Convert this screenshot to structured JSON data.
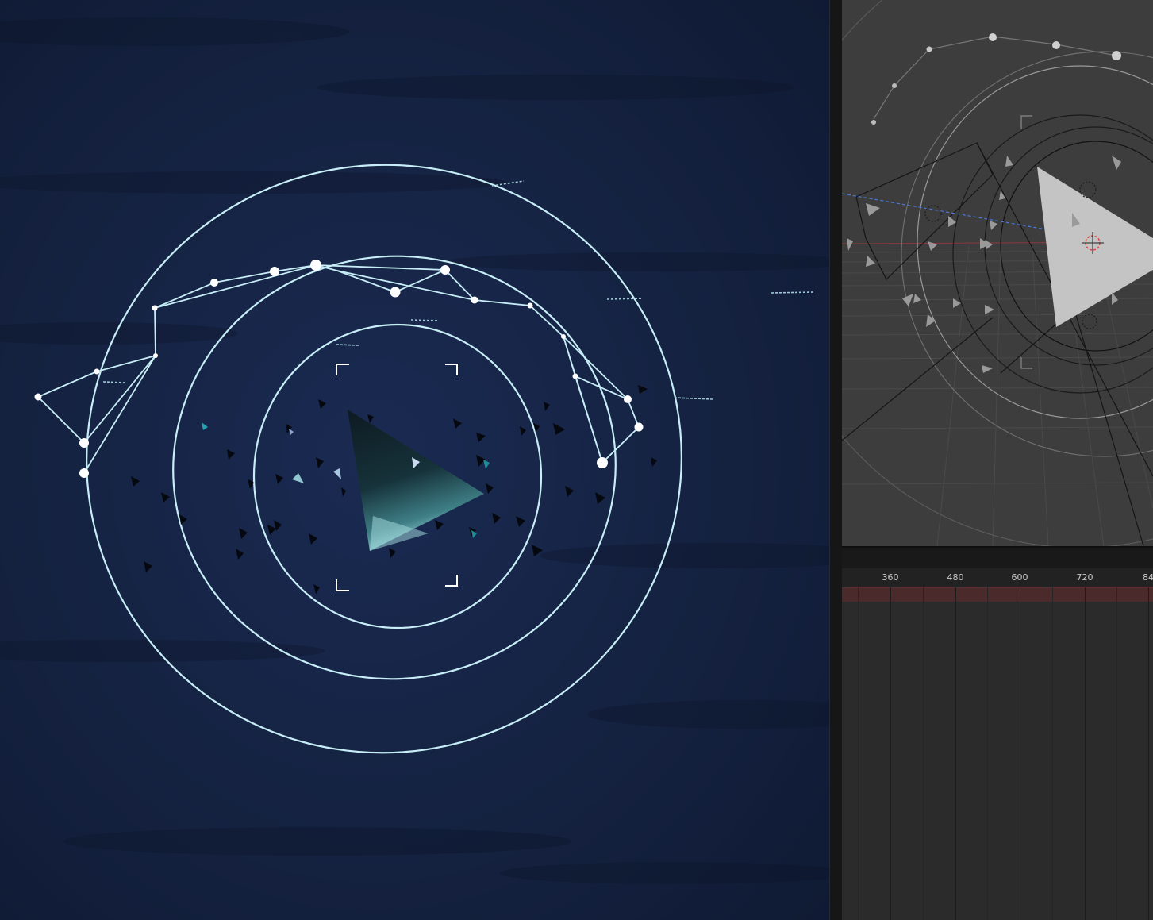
{
  "colors": {
    "render_background": "#14213f",
    "hud_line": "#c7eef6",
    "viewport_background": "#3d3d3d",
    "timeline_background": "#2b2b2b",
    "frame_range": "#4a2a2a"
  },
  "icons": {
    "render_corner_marks": "camera-frame-corner-icon",
    "viewport_cursor": "3d-cursor-icon",
    "viewport_empties": "empty-circle-icon"
  },
  "timeline": {
    "frame_labels": [
      "360",
      "480",
      "600",
      "720",
      "84"
    ]
  }
}
